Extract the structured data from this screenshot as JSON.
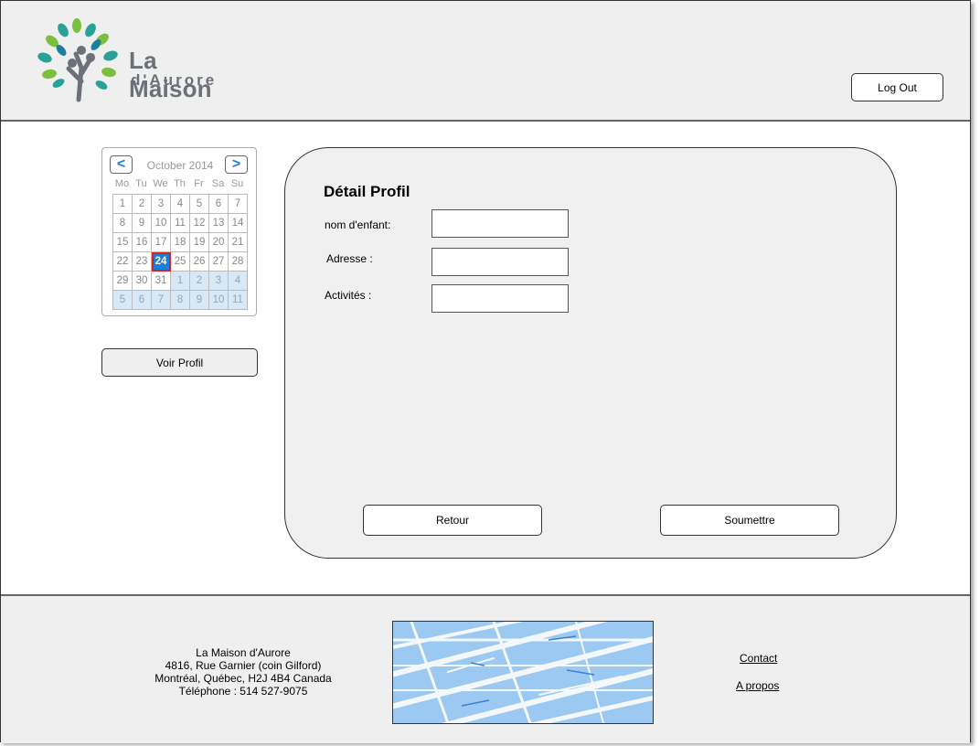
{
  "header": {
    "logo": {
      "line1": "La Maison",
      "line2": "d'Aurore"
    },
    "logout_label": "Log Out"
  },
  "calendar": {
    "month_label": "October 2014",
    "prev_label": "<",
    "next_label": ">",
    "weekdays": [
      "Mo",
      "Tu",
      "We",
      "Th",
      "Fr",
      "Sa",
      "Su"
    ],
    "selected_day": 24,
    "cells": [
      {
        "d": "1",
        "o": false
      },
      {
        "d": "2",
        "o": false
      },
      {
        "d": "3",
        "o": false
      },
      {
        "d": "4",
        "o": false
      },
      {
        "d": "5",
        "o": false
      },
      {
        "d": "6",
        "o": false
      },
      {
        "d": "7",
        "o": false
      },
      {
        "d": "8",
        "o": false
      },
      {
        "d": "9",
        "o": false
      },
      {
        "d": "10",
        "o": false
      },
      {
        "d": "11",
        "o": false
      },
      {
        "d": "12",
        "o": false
      },
      {
        "d": "13",
        "o": false
      },
      {
        "d": "14",
        "o": false
      },
      {
        "d": "15",
        "o": false
      },
      {
        "d": "16",
        "o": false
      },
      {
        "d": "17",
        "o": false
      },
      {
        "d": "18",
        "o": false
      },
      {
        "d": "19",
        "o": false
      },
      {
        "d": "20",
        "o": false
      },
      {
        "d": "21",
        "o": false
      },
      {
        "d": "22",
        "o": false
      },
      {
        "d": "23",
        "o": false
      },
      {
        "d": "24",
        "o": false
      },
      {
        "d": "25",
        "o": false
      },
      {
        "d": "26",
        "o": false
      },
      {
        "d": "27",
        "o": false
      },
      {
        "d": "28",
        "o": false
      },
      {
        "d": "29",
        "o": false
      },
      {
        "d": "30",
        "o": false
      },
      {
        "d": "31",
        "o": false
      },
      {
        "d": "1",
        "o": true
      },
      {
        "d": "2",
        "o": true
      },
      {
        "d": "3",
        "o": true
      },
      {
        "d": "4",
        "o": true
      },
      {
        "d": "5",
        "o": true
      },
      {
        "d": "6",
        "o": true
      },
      {
        "d": "7",
        "o": true
      },
      {
        "d": "8",
        "o": true
      },
      {
        "d": "9",
        "o": true
      },
      {
        "d": "10",
        "o": true
      },
      {
        "d": "11",
        "o": true
      }
    ]
  },
  "sidebar": {
    "voir_profil_label": "Voir Profil"
  },
  "form": {
    "title": "Détail Profil",
    "fields": [
      {
        "label": "nom d'enfant:",
        "value": ""
      },
      {
        "label": "Adresse :",
        "value": ""
      },
      {
        "label": "Activités :",
        "value": ""
      }
    ],
    "retour_label": "Retour",
    "soumettre_label": "Soumettre"
  },
  "footer": {
    "address_lines": [
      "La Maison d'Aurore",
      "4816, Rue Garnier (coin Gilford)",
      "Montréal, Québec, H2J 4B4 Canada",
      "Téléphone : 514 527-9075"
    ],
    "contact_label": "Contact",
    "apropos_label": "A propos"
  }
}
